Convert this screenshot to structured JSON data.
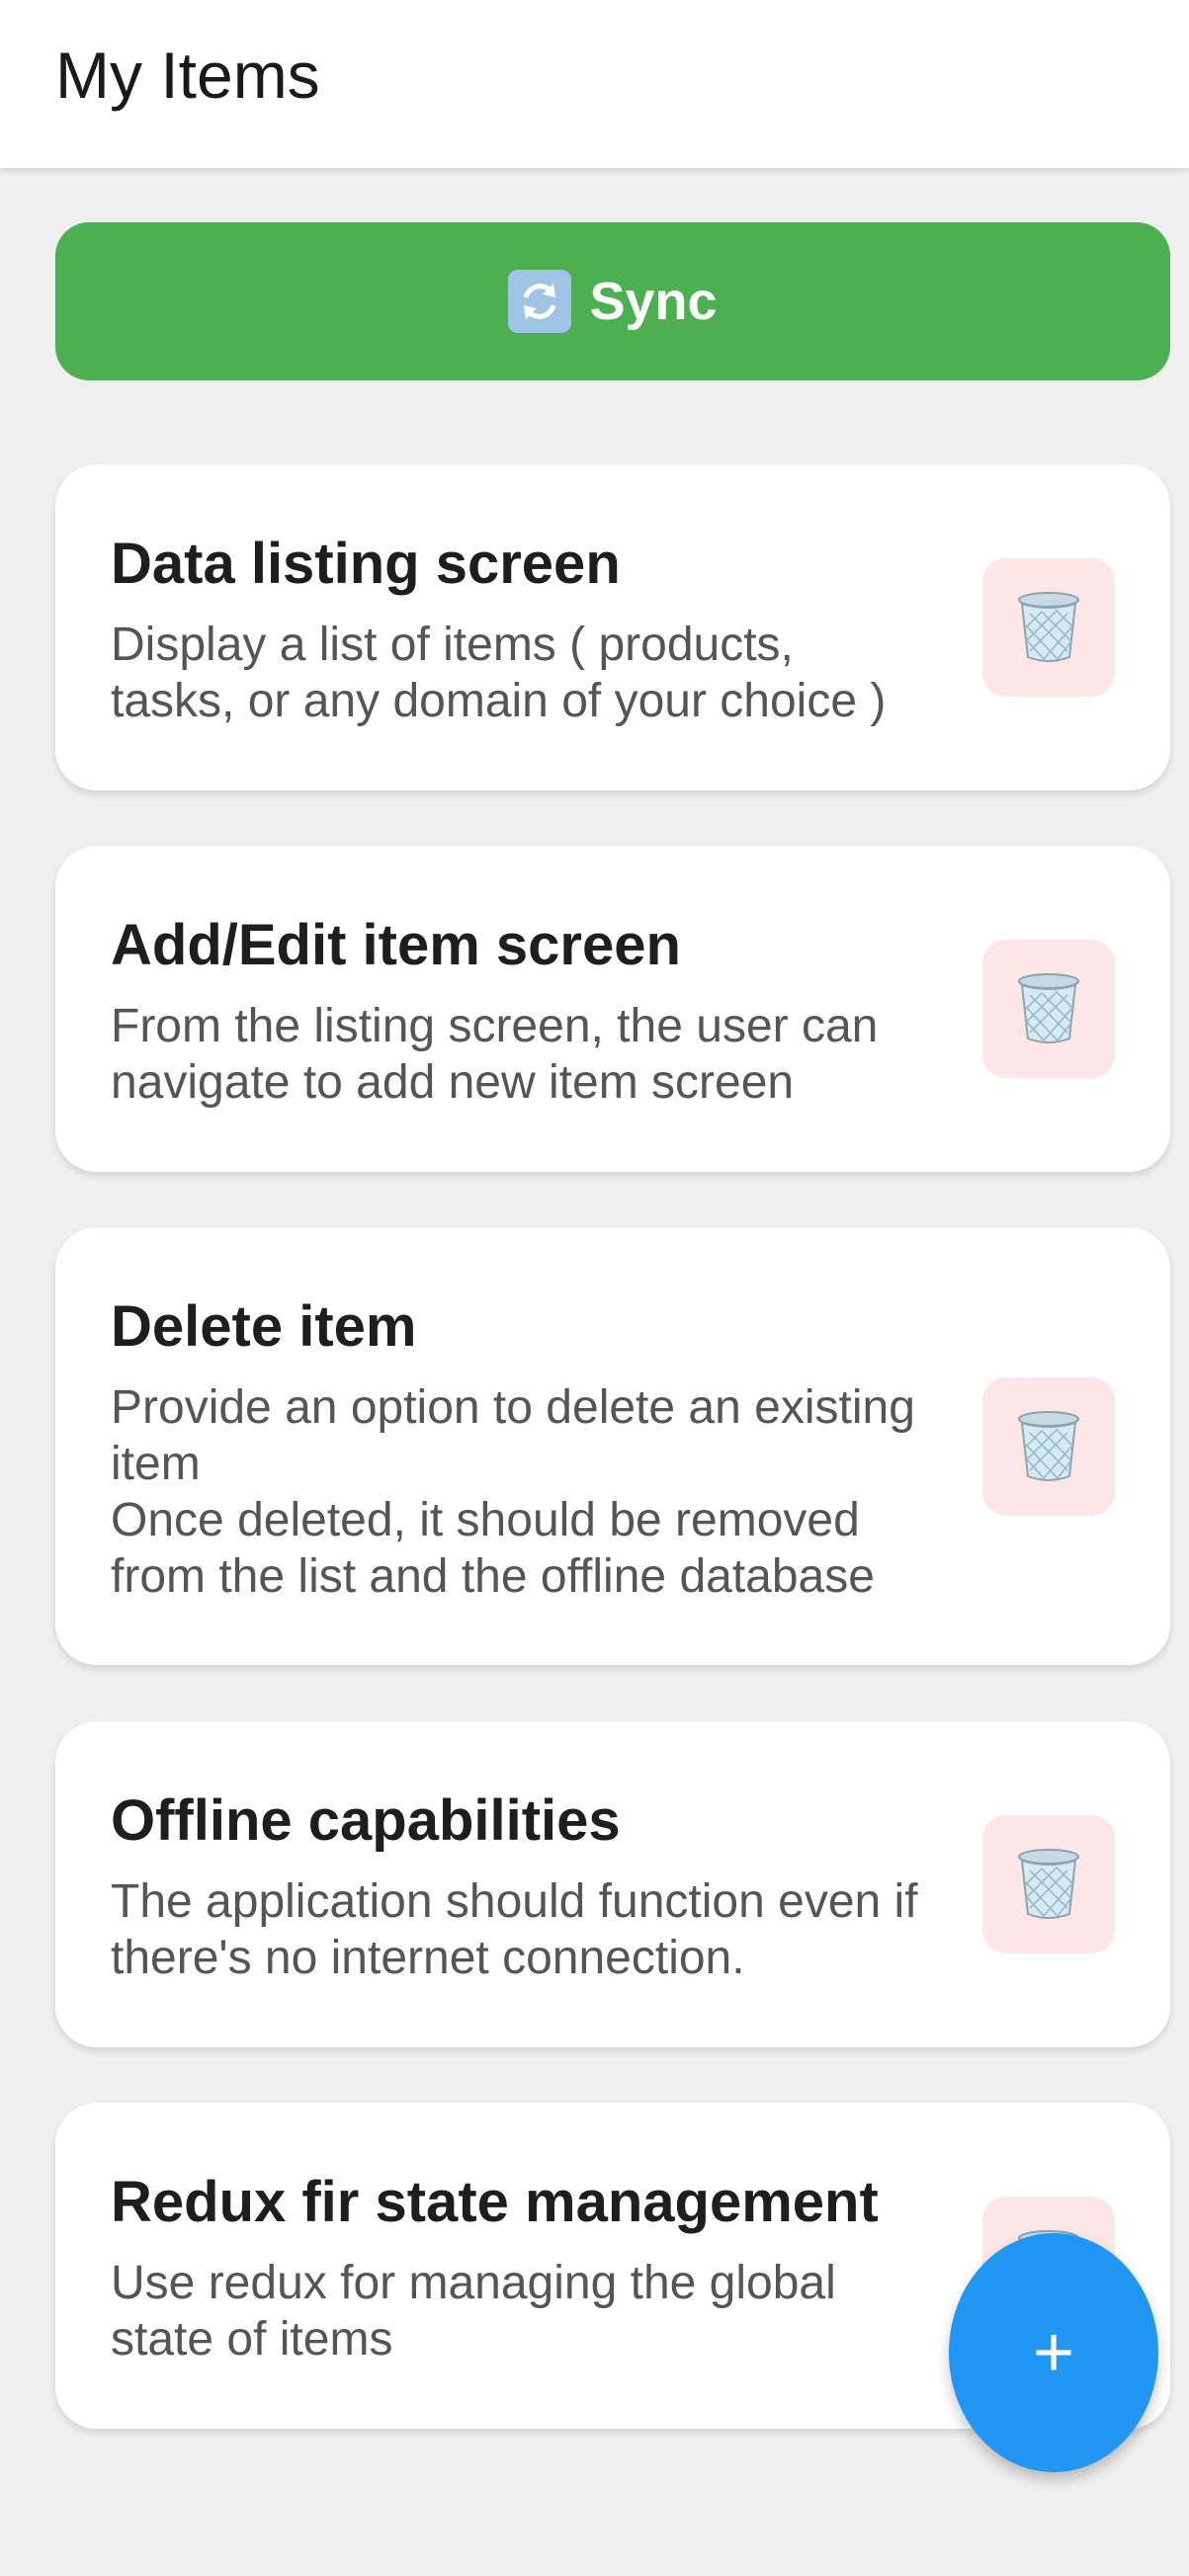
{
  "header": {
    "title": "My Items"
  },
  "sync": {
    "label": "Sync",
    "icon": "sync-arrows-icon",
    "color": "#4caf50"
  },
  "items": [
    {
      "title": "Data listing screen",
      "description": "Display a list of items ( products,\ntasks, or any domain of your choice )"
    },
    {
      "title": "Add/Edit item screen",
      "description": "From the listing screen, the user can\nnavigate to add new item screen"
    },
    {
      "title": "Delete item",
      "description": "Provide an option to delete an existing\nitem\nOnce deleted, it should be removed\nfrom the list and the offline database"
    },
    {
      "title": "Offline capabilities",
      "description": "The application should function even if\nthere's no internet connection."
    },
    {
      "title": "Redux fir state management",
      "description": "Use redux for managing the global\nstate of items"
    }
  ],
  "fab": {
    "label": "+",
    "color": "#2196f3"
  },
  "colors": {
    "delete_bg": "#fde6e6",
    "background": "#f0f0f0"
  }
}
